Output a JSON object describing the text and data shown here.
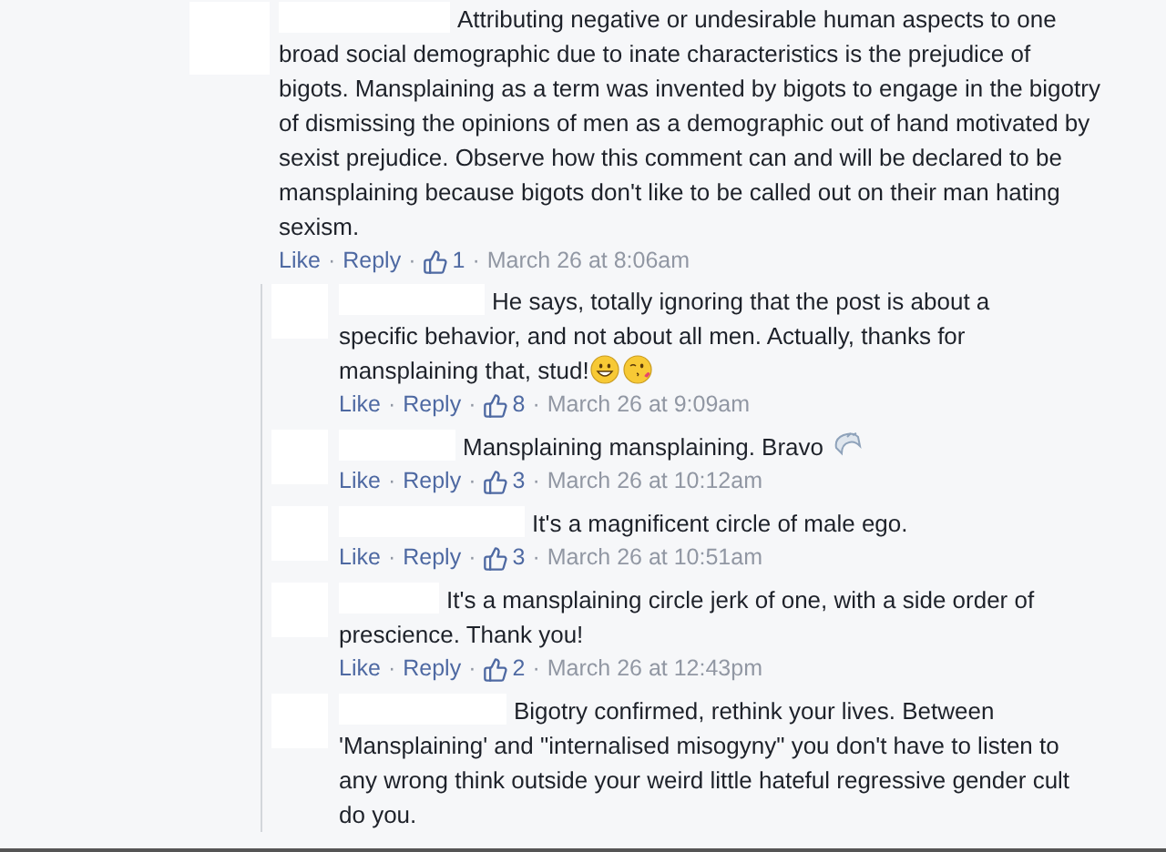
{
  "comment": {
    "text": "Attributing negative or undesirable human aspects to one broad social demographic due to inate characteristics is the prejudice of bigots. Mansplaining as a term was invented by bigots to engage in the bigotry of dismissing the opinions of men as a demographic out of hand motivated by sexist prejudice. Observe how this comment can and will be declared to be mansplaining because bigots don't like to be called out on their man hating sexism.",
    "like": "Like",
    "reply": "Reply",
    "separator": "·",
    "likes": "1",
    "time": "March 26 at 8:06am"
  },
  "replies": [
    {
      "text": "He says, totally ignoring that the post is about a specific behavior, and not about all men. Actually, thanks for mansplaining that, stud!",
      "emoji": [
        {
          "kind": "grin"
        },
        {
          "kind": "kiss"
        }
      ],
      "like": "Like",
      "reply": "Reply",
      "separator": "·",
      "likes": "8",
      "time": "March 26 at 9:09am"
    },
    {
      "text": "Mansplaining mansplaining. Bravo",
      "emoji": [
        {
          "kind": "clap"
        }
      ],
      "like": "Like",
      "reply": "Reply",
      "separator": "·",
      "likes": "3",
      "time": "March 26 at 10:12am"
    },
    {
      "text": "It's a magnificent circle of male ego.",
      "like": "Like",
      "reply": "Reply",
      "separator": "·",
      "likes": "3",
      "time": "March 26 at 10:51am"
    },
    {
      "text": "It's a mansplaining circle jerk of one, with a side order of prescience. Thank you!",
      "like": "Like",
      "reply": "Reply",
      "separator": "·",
      "likes": "2",
      "time": "March 26 at 12:43pm"
    },
    {
      "text": "Bigotry confirmed, rethink your lives. Between 'Mansplaining' and \"internalised misogyny\" you don't have to listen to any wrong think outside your weird little hateful regressive gender cult do you."
    }
  ]
}
